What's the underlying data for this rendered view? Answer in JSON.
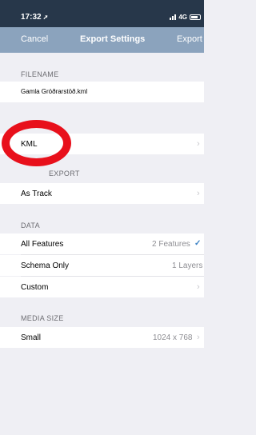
{
  "status_bar": {
    "time": "17:32",
    "network": "4G"
  },
  "nav": {
    "cancel_label": "Cancel",
    "title": "Export Settings",
    "export_label": "Export"
  },
  "filename_section": {
    "header": "FILENAME",
    "value": "Gamla Gróðrarstöð.kml"
  },
  "format_row": {
    "label": "KML"
  },
  "export_section": {
    "header_visible": "EXPORT",
    "value": "As Track"
  },
  "data_section": {
    "header": "DATA",
    "rows": [
      {
        "label": "All Features",
        "value": "2 Features",
        "checked": true
      },
      {
        "label": "Schema Only",
        "value": "1 Layers"
      },
      {
        "label": "Custom",
        "value": ""
      }
    ]
  },
  "media_section": {
    "header": "MEDIA SIZE",
    "label": "Small",
    "value": "1024 x 768"
  },
  "colors": {
    "status_bar_bg": "#27374a",
    "nav_bar_bg": "#8ba3bd",
    "check_color": "#3b82c4",
    "annotation_circle": "#e8101b"
  },
  "icons": [
    "location-arrow-icon",
    "signal-bars-icon",
    "battery-icon",
    "chevron-right-icon",
    "checkmark-icon"
  ]
}
